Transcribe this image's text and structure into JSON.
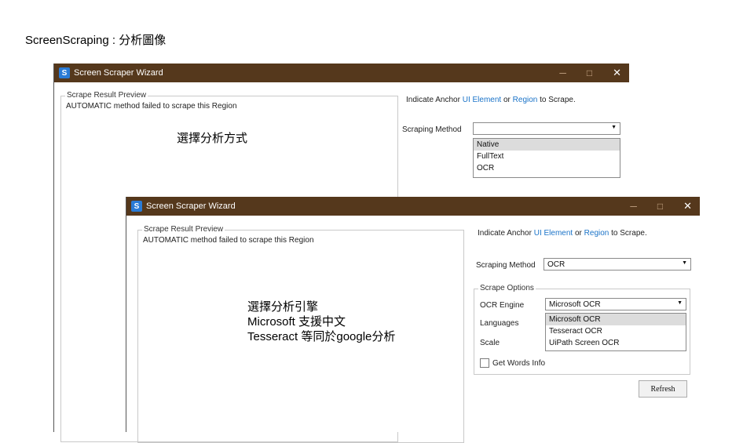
{
  "slide": {
    "title": "ScreenScraping : 分析圖像"
  },
  "window1": {
    "icon_letter": "S",
    "title": "Screen Scraper Wizard",
    "controls": {
      "minimize": "─",
      "maximize": "□",
      "close": "✕"
    },
    "preview": {
      "label": "Scrape Result Preview",
      "message": "AUTOMATIC method failed to scrape this Region"
    },
    "anchor": {
      "prefix": "Indicate Anchor",
      "link1": "UI Element",
      "middle": "or",
      "link2": "Region",
      "suffix": "to Scrape."
    },
    "scraping_method": {
      "label": "Scraping Method",
      "value": "",
      "options": [
        "Native",
        "FullText",
        "OCR"
      ],
      "highlighted": "Native"
    },
    "annotation": "選擇分析方式"
  },
  "window2": {
    "icon_letter": "S",
    "title": "Screen Scraper Wizard",
    "controls": {
      "minimize": "─",
      "maximize": "□",
      "close": "✕"
    },
    "preview": {
      "label": "Scrape Result Preview",
      "message": "AUTOMATIC method failed to scrape this Region"
    },
    "anchor": {
      "prefix": "Indicate Anchor",
      "link1": "UI Element",
      "middle": "or",
      "link2": "Region",
      "suffix": "to Scrape."
    },
    "scraping_method": {
      "label": "Scraping Method",
      "value": "OCR"
    },
    "scrape_options": {
      "label": "Scrape Options",
      "ocr_engine": {
        "label": "OCR Engine",
        "value": "Microsoft OCR",
        "options": [
          "Microsoft OCR",
          "Tesseract OCR",
          "UiPath Screen OCR"
        ],
        "highlighted": "Microsoft OCR"
      },
      "languages_label": "Languages",
      "scale_label": "Scale",
      "get_words_info": {
        "label": "Get Words Info",
        "checked": false
      }
    },
    "refresh_button": "Refresh",
    "annotation": {
      "line1": "選擇分析引擎",
      "line2": "Microsoft 支援中文",
      "line3": "Tesseract 等同於google分析"
    }
  },
  "icons": {
    "dropdown_arrow": "▼"
  }
}
